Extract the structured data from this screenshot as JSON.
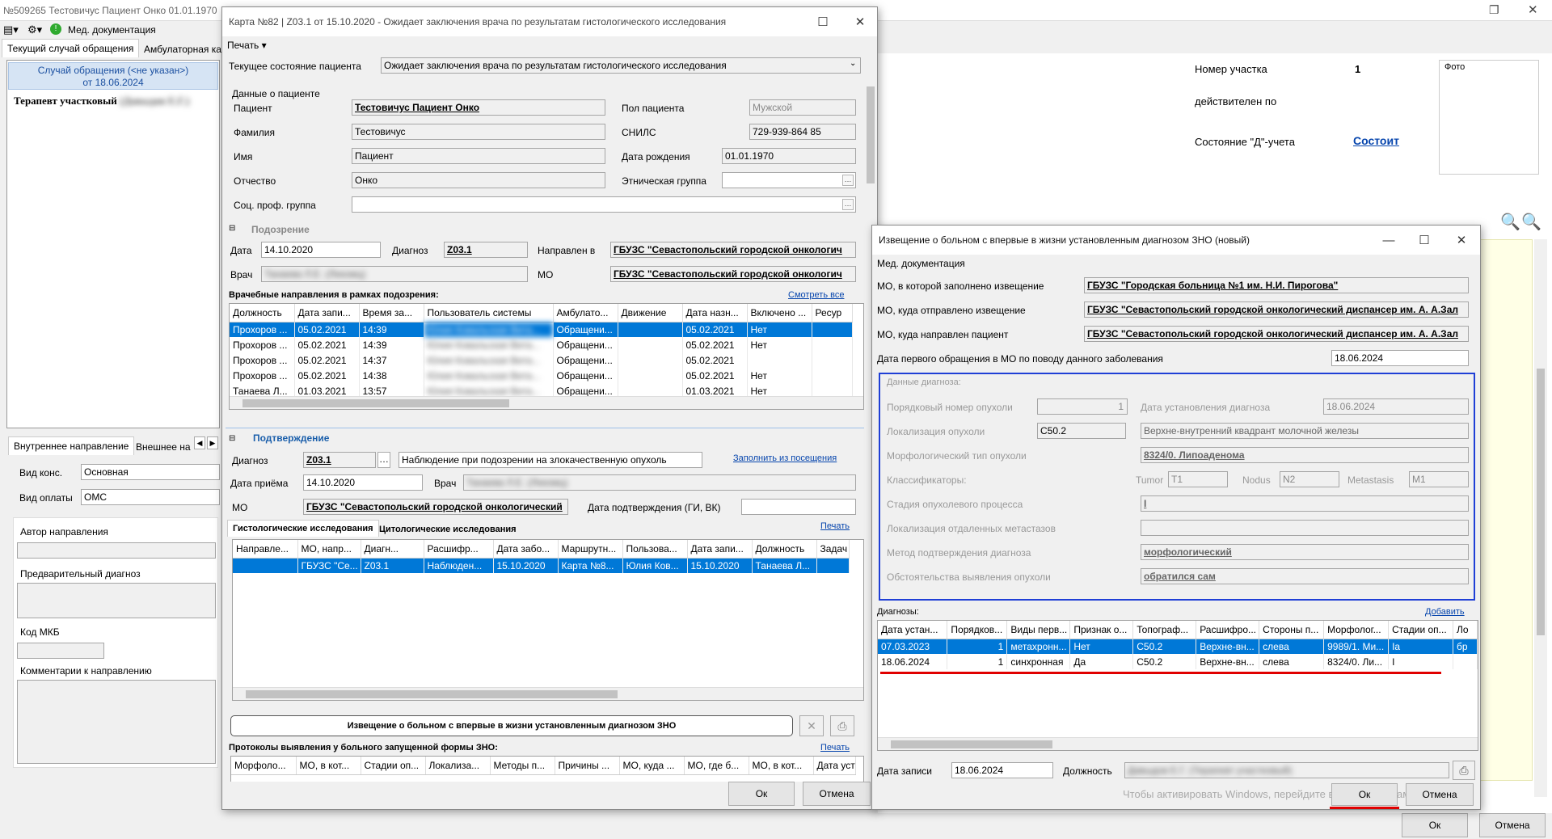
{
  "main": {
    "title": "№509265 Тестовичус Пациент Онко 01.01.1970",
    "toolbar_doc": "Мед. документация",
    "tabs": [
      "Текущий случай обращения",
      "Амбулаторная ка"
    ],
    "case_line1": "Случай обращения (<не указан>)",
    "case_line2": "от 18.06.2024",
    "tree_item": "Терапевт участковый",
    "tree_item_blur": "(Давыдов Е.Г.)",
    "tabs2": [
      "Внутреннее направление",
      "Внешнее на"
    ],
    "kind_label": "Вид конс.",
    "kind_value": "Основная",
    "pay_label": "Вид оплаты",
    "pay_value": "ОМС",
    "author_label": "Автор направления",
    "prediag_label": "Предварительный диагноз",
    "mkb_label": "Код МКБ",
    "comment_label": "Комментарии к направлению",
    "site_label": "Номер участка",
    "site_value": "1",
    "valid_label": "действителен по",
    "dstate_label": "Состояние \"Д\"-учета",
    "dstate_value": "Состоит",
    "photo_label": "Фото",
    "ok": "Ок",
    "cancel": "Отмена"
  },
  "card": {
    "title": "Карта №82 | Z03.1 от 15.10.2020 - Ожидает заключения врача по результатам гистологического исследования",
    "print": "Печать",
    "state_label": "Текущее состояние пациента",
    "state_value": "Ожидает заключения врача по результатам гистологического исследования",
    "patient_section": "Данные о пациенте",
    "patient_label": "Пациент",
    "patient_value": "Тестовичус Пациент Онко",
    "sex_label": "Пол пациента",
    "sex_value": "Мужской",
    "surname_label": "Фамилия",
    "surname_value": "Тестовичус",
    "snils_label": "СНИЛС",
    "snils_value": "729-939-864 85",
    "name_label": "Имя",
    "name_value": "Пациент",
    "dob_label": "Дата рождения",
    "dob_value": "01.01.1970",
    "patr_label": "Отчество",
    "patr_value": "Онко",
    "eth_label": "Этническая группа",
    "soc_label": "Соц. проф. группа",
    "susp_section": "Подозрение",
    "date_label": "Дата",
    "date_value": "14.10.2020",
    "diag_label": "Диагноз",
    "diag_value": "Z03.1",
    "sent_label": "Направлен в",
    "sent_value": "ГБУЗС \"Севастопольский городской онкологич",
    "doc_label": "Врач",
    "doc_value": "Танаева Л.Е. (Лекомц)",
    "mo_label": "МО",
    "mo_value": "ГБУЗС \"Севастопольский городской онкологич",
    "refs_label": "Врачебные направления в рамках подозрения:",
    "refs_link": "Смотреть все",
    "refs_cols": [
      "Должность",
      "Дата запи...",
      "Время за...",
      "Пользователь системы",
      "Амбулато...",
      "Движение",
      "Дата назн...",
      "Включено ...",
      "Ресур"
    ],
    "refs_rows": [
      [
        "Прохоров ...",
        "05.02.2021",
        "14:39",
        "Юлия Ковальская Вита...",
        "Обращени...",
        "",
        "05.02.2021",
        "Нет",
        ""
      ],
      [
        "Прохоров ...",
        "05.02.2021",
        "14:39",
        "Юлия Ковальская Вита...",
        "Обращени...",
        "",
        "05.02.2021",
        "Нет",
        ""
      ],
      [
        "Прохоров ...",
        "05.02.2021",
        "14:37",
        "Юлия Ковальская Вита...",
        "Обращени...",
        "",
        "05.02.2021",
        "",
        ""
      ],
      [
        "Прохоров ...",
        "05.02.2021",
        "14:38",
        "Юлия Ковальская Вита...",
        "Обращени...",
        "",
        "05.02.2021",
        "Нет",
        ""
      ],
      [
        "Танаева Л...",
        "01.03.2021",
        "13:57",
        "Юлия Ковальская Вита...",
        "Обращени...",
        "",
        "01.03.2021",
        "Нет",
        ""
      ]
    ],
    "conf_section": "Подтверждение",
    "cdiag_label": "Диагноз",
    "cdiag_value": "Z03.1",
    "cdiag_text": "Наблюдение при подозрении на злокачественную опухоль",
    "fill_link": "Заполнить из посещения",
    "adm_label": "Дата приёма",
    "adm_value": "14.10.2020",
    "cdoc_label": "Врач",
    "cdoc_value": "Танаева Л.Е. (Лекомц)",
    "cmo_label": "МО",
    "cmo_value": "ГБУЗС \"Севастопольский городской онкологический",
    "confdate_label": "Дата подтверждения (ГИ, ВК)",
    "histo_tabs": [
      "Гистологические исследования",
      "Цитологические исследования"
    ],
    "histo_print": "Печать",
    "histo_cols": [
      "Направле...",
      "МО, напр...",
      "Диагн...",
      "Расшифр...",
      "Дата забо...",
      "Маршрутн...",
      "Пользова...",
      "Дата запи...",
      "Должность",
      "Задач"
    ],
    "histo_row": [
      "",
      "ГБУЗС \"Се...",
      "Z03.1",
      "Наблюден...",
      "15.10.2020",
      "Карта №8...",
      "Юлия Ков...",
      "15.10.2020",
      "Танаева Л...",
      ""
    ],
    "notice_btn": "Извещение о больном с впервые в жизни установленным диагнозом ЗНО",
    "proto_label": "Протоколы выявления у больного запущенной формы ЗНО:",
    "proto_print": "Печать",
    "proto_cols": [
      "Морфоло...",
      "МО, в кот...",
      "Стадии оп...",
      "Локализа...",
      "Методы п...",
      "Причины ...",
      "МО, куда ...",
      "МО, где б...",
      "МО, в кот...",
      "Дата уст"
    ],
    "ok": "Ок",
    "cancel": "Отмена"
  },
  "notice": {
    "title": "Извещение о больном с впервые в жизни установленным диагнозом ЗНО (новый)",
    "menu": "Мед. документация",
    "mo_fill_label": "МО, в которой заполнено извещение",
    "mo_fill_value": "ГБУЗС \"Городская больница №1 им. Н.И. Пирогова\"",
    "mo_sent_label": "МО, куда отправлено извещение",
    "mo_sent_value": "ГБУЗС \"Севастопольский городской онкологический диспансер им. А. А.Зал",
    "mo_dir_label": "МО, куда направлен пациент",
    "mo_dir_value": "ГБУЗС \"Севастопольский городской онкологический диспансер им. А. А.Зал",
    "first_label": "Дата первого обращения в МО по поводу данного заболевания",
    "first_value": "18.06.2024",
    "dd_section": "Данные диагноза:",
    "tnum_label": "Порядковый номер опухоли",
    "tnum_value": "1",
    "dset_label": "Дата установления диагноза",
    "dset_value": "18.06.2024",
    "loc_label": "Локализация опухоли",
    "loc_code": "C50.2",
    "loc_text": "Верхне-внутренний квадрант молочной железы",
    "morph_label": "Морфологический тип опухоли",
    "morph_value": "8324/0. Липоаденома",
    "cls_label": "Классификаторы:",
    "tumor_label": "Tumor",
    "tumor_value": "T1",
    "nodus_label": "Nodus",
    "nodus_value": "N2",
    "meta_label": "Metastasis",
    "meta_value": "M1",
    "stage_label": "Стадия опухолевого процесса",
    "stage_value": "I",
    "metloc_label": "Локализация отдаленных метастазов",
    "method_label": "Метод подтверждения диагноза",
    "method_value": "морфологический",
    "circ_label": "Обстоятельства выявления опухоли",
    "circ_value": "обратился сам",
    "diags_label": "Диагнозы:",
    "add_link": "Добавить",
    "diag_cols": [
      "Дата устан...",
      "Порядков...",
      "Виды перв...",
      "Признак о...",
      "Топограф...",
      "Расшифро...",
      "Стороны п...",
      "Морфолог...",
      "Стадии оп...",
      "Ло"
    ],
    "diag_rows": [
      [
        "07.03.2023",
        "1",
        "метахронн...",
        "Нет",
        "C50.2",
        "Верхне-вн...",
        "слева",
        "9989/1. Ми...",
        "Ia",
        "бр"
      ],
      [
        "18.06.2024",
        "1",
        "синхронная",
        "Да",
        "C50.2",
        "Верхне-вн...",
        "слева",
        "8324/0. Ли...",
        "I",
        ""
      ]
    ],
    "rec_label": "Дата записи",
    "rec_value": "18.06.2024",
    "pos_label": "Должность",
    "pos_value": "Давыдов Е.Г. (Терапевт участковый)",
    "watermark": "Чтобы активировать Windows, перейдите в раздел \"Параметры\".",
    "ok": "Ок",
    "cancel": "Отмена"
  },
  "colors": {
    "selection": "#0078d7",
    "link": "#0645ad",
    "section": "#1b5fab",
    "highlight_border": "#1f3fd6",
    "red_line": "#e00000"
  }
}
